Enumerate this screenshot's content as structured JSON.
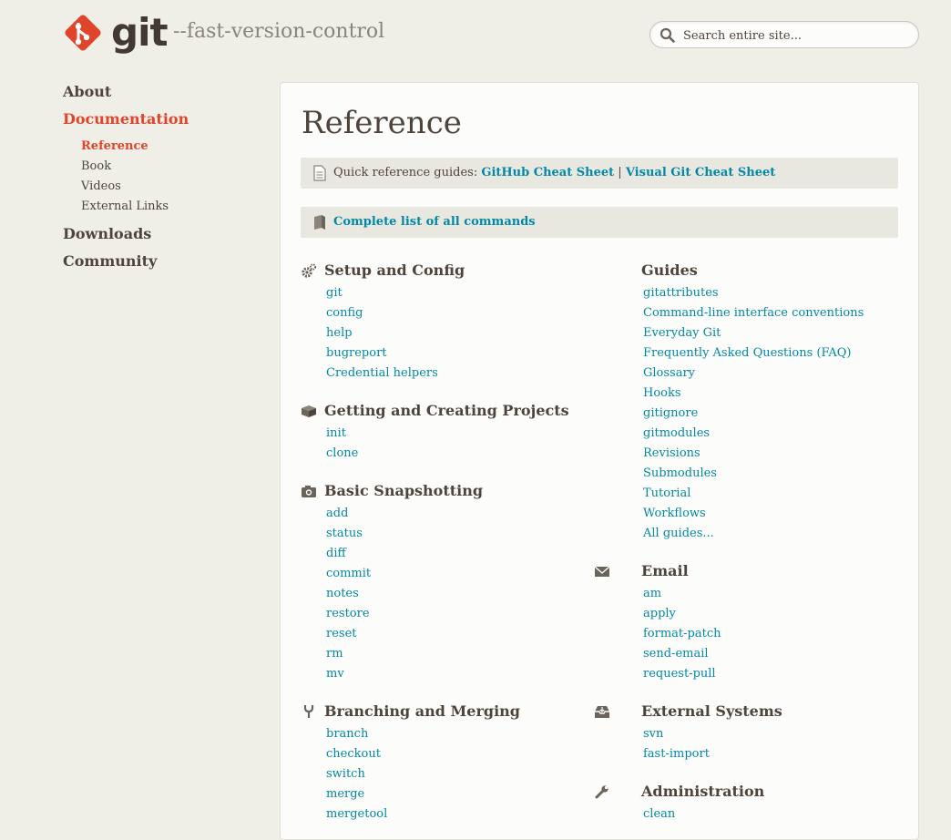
{
  "header": {
    "logo_text": "git",
    "tagline": "--fast-version-control",
    "search_placeholder": "Search entire site..."
  },
  "sidebar": {
    "items": [
      {
        "label": "About"
      },
      {
        "label": "Documentation",
        "children": [
          "Reference",
          "Book",
          "Videos",
          "External Links"
        ]
      },
      {
        "label": "Downloads"
      },
      {
        "label": "Community"
      }
    ]
  },
  "main": {
    "title": "Reference",
    "quick_ref": {
      "prefix": "Quick reference guides:",
      "link1": "GitHub Cheat Sheet",
      "sep": "|",
      "link2": "Visual Git Cheat Sheet"
    },
    "all_commands": "Complete list of all commands",
    "sections": {
      "setup": {
        "title": "Setup and Config",
        "icon": "gears-icon",
        "items": [
          "git",
          "config",
          "help",
          "bugreport",
          "Credential helpers"
        ]
      },
      "projects": {
        "title": "Getting and Creating Projects",
        "icon": "box-icon",
        "items": [
          "init",
          "clone"
        ]
      },
      "snapshot": {
        "title": "Basic Snapshotting",
        "icon": "camera-icon",
        "items": [
          "add",
          "status",
          "diff",
          "commit",
          "notes",
          "restore",
          "reset",
          "rm",
          "mv"
        ]
      },
      "branching": {
        "title": "Branching and Merging",
        "icon": "branch-icon",
        "items": [
          "branch",
          "checkout",
          "switch",
          "merge",
          "mergetool"
        ]
      },
      "guides": {
        "title": "Guides",
        "items": [
          "gitattributes",
          "Command-line interface conventions",
          "Everyday Git",
          "Frequently Asked Questions (FAQ)",
          "Glossary",
          "Hooks",
          "gitignore",
          "gitmodules",
          "Revisions",
          "Submodules",
          "Tutorial",
          "Workflows",
          "All guides..."
        ]
      },
      "email": {
        "title": "Email",
        "icon": "envelope-icon",
        "items": [
          "am",
          "apply",
          "format-patch",
          "send-email",
          "request-pull"
        ]
      },
      "external": {
        "title": "External Systems",
        "icon": "inbox-icon",
        "items": [
          "svn",
          "fast-import"
        ]
      },
      "admin": {
        "title": "Administration",
        "icon": "wrench-icon",
        "items": [
          "clean"
        ]
      }
    }
  },
  "colors": {
    "background": "#f0efe7",
    "accent": "#e0442b",
    "link": "#0388a6",
    "text": "#4e443c"
  }
}
